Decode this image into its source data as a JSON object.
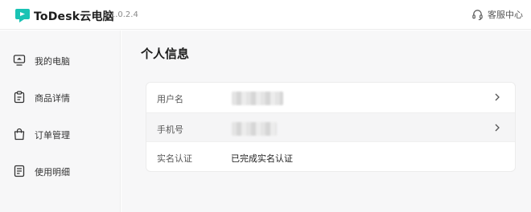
{
  "app": {
    "name": "ToDesk云电脑",
    "version": "V1.0.2.4",
    "support_label": "客服中心",
    "accent_color": "#19c3b4"
  },
  "sidebar": {
    "items": [
      {
        "label": "我的电脑",
        "icon": "computer-icon"
      },
      {
        "label": "商品详情",
        "icon": "clipboard-icon"
      },
      {
        "label": "订单管理",
        "icon": "shopping-bag-icon"
      },
      {
        "label": "使用明细",
        "icon": "list-document-icon"
      }
    ]
  },
  "main": {
    "title": "个人信息",
    "rows": [
      {
        "label": "用户名",
        "value_masked": true
      },
      {
        "label": "手机号",
        "value_masked": true
      },
      {
        "label": "实名认证",
        "value": "已完成实名认证"
      }
    ]
  }
}
